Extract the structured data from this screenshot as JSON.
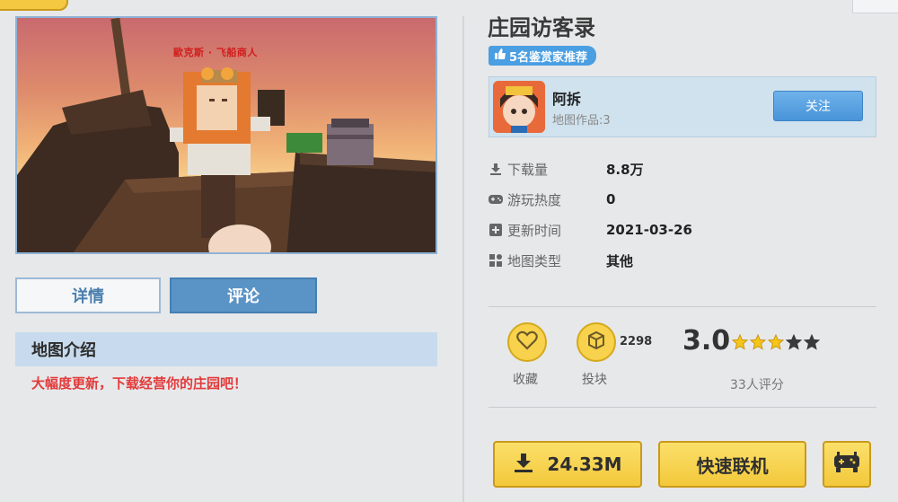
{
  "map": {
    "title": "庄园访客录",
    "recommend_badge": "5名鉴赏家推荐",
    "preview_nametag": "歐克斯 · 飞船商人"
  },
  "author": {
    "name": "阿拆",
    "works": "地图作品:3",
    "follow_label": "关注"
  },
  "stats": [
    {
      "icon": "download-icon",
      "label": "下载量",
      "value": "8.8万"
    },
    {
      "icon": "gamepad-icon",
      "label": "游玩热度",
      "value": "0"
    },
    {
      "icon": "plus-box-icon",
      "label": "更新时间",
      "value": "2021-03-26"
    },
    {
      "icon": "grid-icon",
      "label": "地图类型",
      "value": "其他"
    }
  ],
  "tabs": [
    {
      "label": "详情"
    },
    {
      "label": "评论"
    }
  ],
  "intro": {
    "heading": "地图介绍",
    "text": "大幅度更新，下载经营你的庄园吧！"
  },
  "actions": {
    "favorite_label": "收藏",
    "coin_label": "投块",
    "coin_count": "2298"
  },
  "rating": {
    "score": "3.0",
    "filled_stars": 3,
    "total_stars": 5,
    "count_text": "33人评分"
  },
  "buttons": {
    "download_label": "24.33M",
    "quick_connect_label": "快速联机"
  },
  "colors": {
    "accent_blue": "#5a93c6",
    "button_yellow": "#f8d24c",
    "intro_red": "#e33b3b"
  }
}
